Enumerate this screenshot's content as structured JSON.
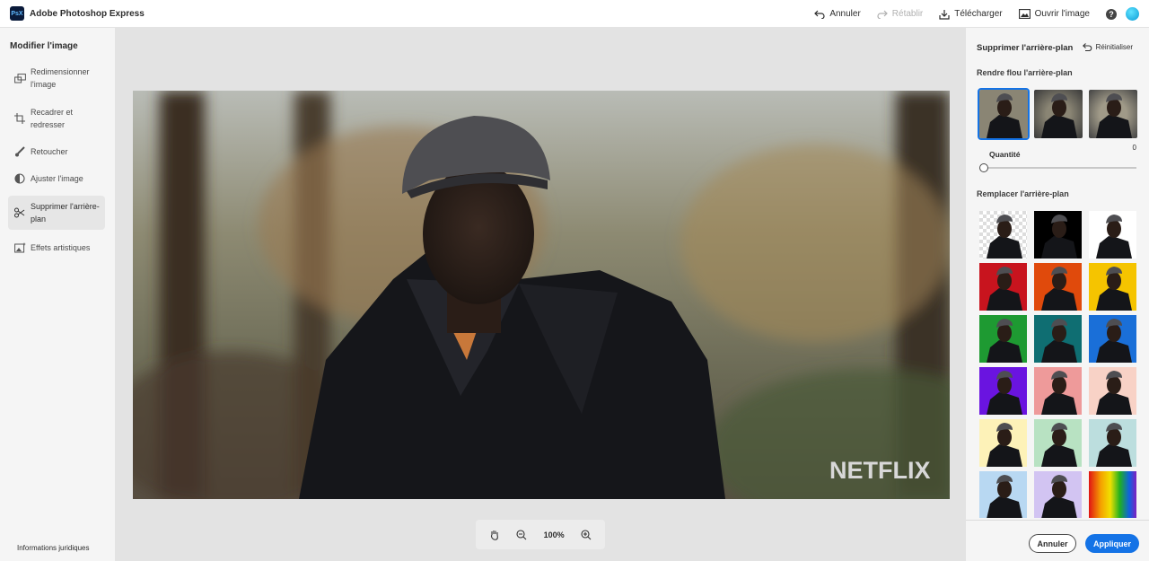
{
  "app": {
    "title": "Adobe Photoshop Express",
    "logo_text": "PsX"
  },
  "topbar": {
    "undo": "Annuler",
    "redo": "Rétablir",
    "download": "Télécharger",
    "open_image": "Ouvrir l'image",
    "help": "?"
  },
  "left_panel": {
    "title": "Modifier l'image",
    "items": [
      {
        "label": "Redimensionner l'image",
        "icon": "resize-icon"
      },
      {
        "label": "Recadrer et redresser",
        "icon": "crop-icon"
      },
      {
        "label": "Retoucher",
        "icon": "brush-icon"
      },
      {
        "label": "Ajuster l'image",
        "icon": "adjust-icon"
      },
      {
        "label": "Supprimer l'arrière-plan",
        "icon": "scissors-icon",
        "active": true
      },
      {
        "label": "Effets artistiques",
        "icon": "effects-icon"
      }
    ],
    "legal": "Informations juridiques"
  },
  "canvas": {
    "watermark": "NETFLIX",
    "zoom": "100%"
  },
  "right_panel": {
    "title": "Supprimer l'arrière-plan",
    "reset": "Réinitialiser",
    "blur_section": "Rendre flou l'arrière-plan",
    "quantity_label": "Quantité",
    "quantity_value": "0",
    "quantity": 0,
    "replace_section": "Remplacer l'arrière-plan",
    "swatch_colors": [
      "transparent",
      "#000000",
      "#ffffff",
      "#c8141e",
      "#e04a0c",
      "#f5c400",
      "#1e9a32",
      "#0f6e72",
      "#1a6fd8",
      "#6a14e0",
      "#ee9a9a",
      "#f8d2c6",
      "#fdf2b8",
      "#b8e2c2",
      "#bcdede",
      "#b8d8f2",
      "#d2c4f2",
      "rainbow"
    ],
    "cancel": "Annuler",
    "apply": "Appliquer"
  },
  "colors": {
    "accent": "#1473e6"
  }
}
